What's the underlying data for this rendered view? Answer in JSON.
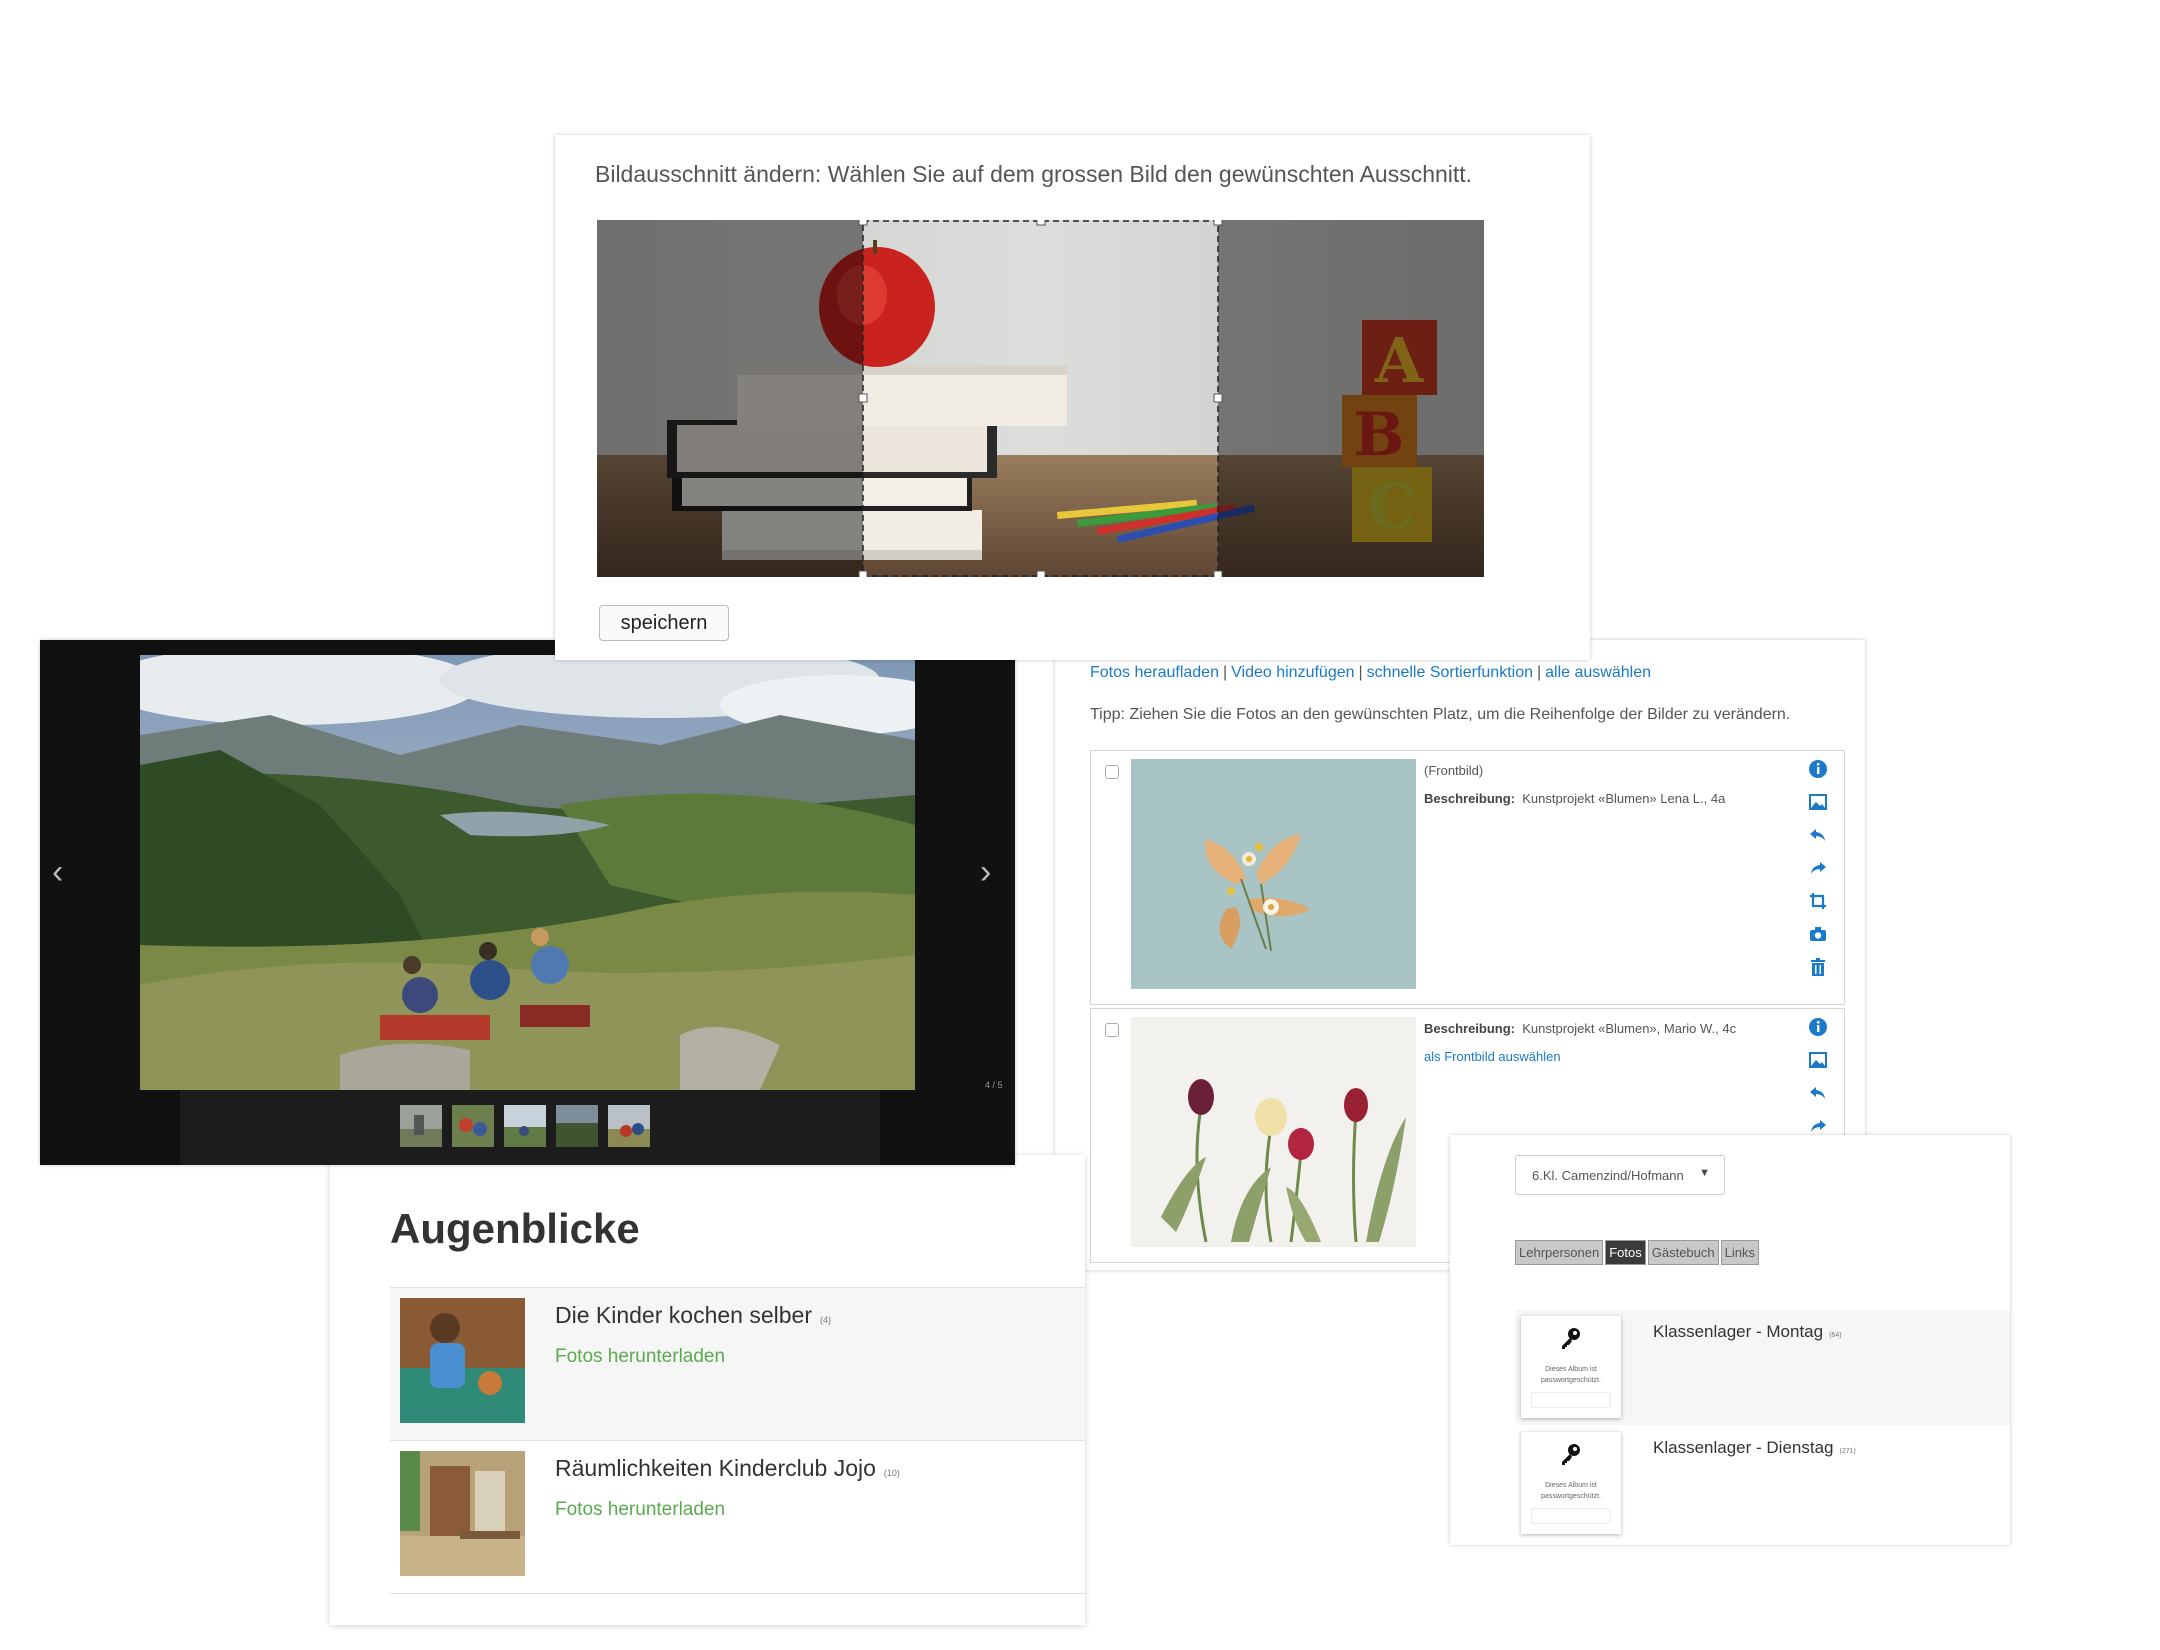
{
  "crop": {
    "instruction": "Bildausschnitt ändern: Wählen Sie auf dem grossen Bild den gewünschten Ausschnitt.",
    "save_label": "speichern"
  },
  "admin": {
    "actions": [
      "Fotos heraufladen",
      "Video hinzufügen",
      "schnelle Sortierfunktion",
      "alle auswählen"
    ],
    "separator": "|",
    "tip": "Tipp: Ziehen Sie die Fotos an den gewünschten Platz, um die Reihenfolge der Bilder zu verändern.",
    "photos": [
      {
        "frontbild": "(Frontbild)",
        "desc_label": "Beschreibung:",
        "desc": "Kunstprojekt «Blumen» Lena L., 4a"
      },
      {
        "desc_label": "Beschreibung:",
        "desc": "Kunstprojekt «Blumen», Mario W., 4c",
        "set_front": "als Frontbild auswählen"
      }
    ],
    "icon_names": [
      "info-icon",
      "image-icon",
      "rotate-left-icon",
      "rotate-right-icon",
      "crop-icon",
      "camera-icon",
      "trash-icon"
    ],
    "accent": "#1a7ac9"
  },
  "lightbox": {
    "counter": "4 / 5",
    "prev_glyph": "‹",
    "next_glyph": "›"
  },
  "albums": {
    "title": "Augenblicke",
    "items": [
      {
        "name": "Die Kinder kochen selber",
        "count": "(4)",
        "download": "Fotos herunterladen"
      },
      {
        "name": "Räumlichkeiten Kinderclub Jojo",
        "count": "(10)",
        "download": "Fotos herunterladen"
      }
    ],
    "link_color": "#5aab4f"
  },
  "class": {
    "select_value": "6.Kl. Camenzind/Hofmann",
    "tabs": [
      "Lehrpersonen",
      "Fotos",
      "Gästebuch",
      "Links"
    ],
    "active_tab": "Fotos",
    "albums": [
      {
        "name": "Klassenlager - Montag",
        "count": "(64)",
        "locked_text": "Dieses Album ist passwortgeschützt."
      },
      {
        "name": "Klassenlager - Dienstag",
        "count": "(271)",
        "locked_text": "Dieses Album ist passwortgeschützt."
      }
    ]
  }
}
